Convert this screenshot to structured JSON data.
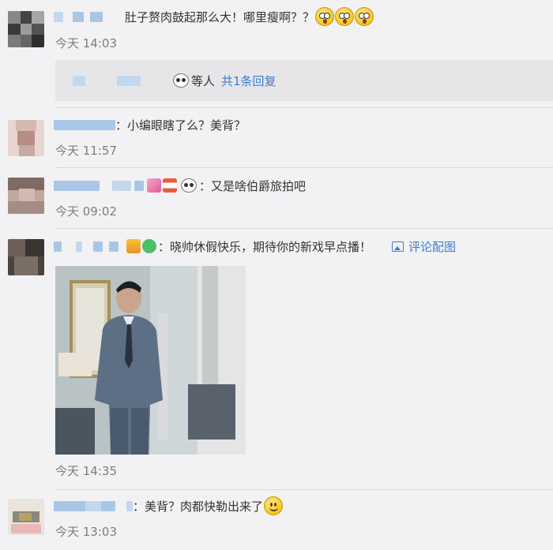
{
  "comments": [
    {
      "text": "肚子赘肉鼓起那么大！哪里瘦啊？？",
      "time": "今天 14:03",
      "reply": {
        "suffix": "等人",
        "link": "共1条回复"
      }
    },
    {
      "sep": "：",
      "text": "小编眼瞎了么？美背？",
      "time": "今天 11:57"
    },
    {
      "sep": "：",
      "text": "又是啥伯爵旅拍吧",
      "time": "今天 09:02"
    },
    {
      "sep": "：",
      "text": "晓帅休假快乐，期待你的新戏早点播！",
      "action": "评论配图",
      "time": "今天 14:35"
    },
    {
      "sep": "：",
      "text": "美背？肉都快勒出来了",
      "time": "今天 13:03"
    }
  ],
  "icons": {
    "shock": "shocked-face-icon",
    "smile": "smiling-face-icon",
    "panda": "panda-icon",
    "image": "image-icon"
  },
  "colors": {
    "link": "#3d7ccf",
    "background": "#f2f2f4",
    "time": "#7d7d7d"
  }
}
